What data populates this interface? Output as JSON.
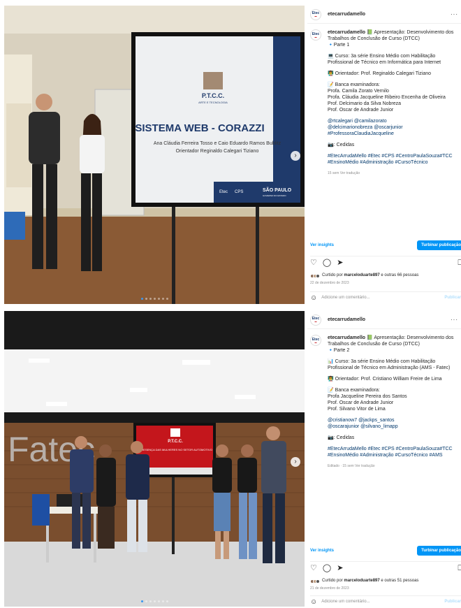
{
  "account": "etecarrudamello",
  "avatar_label": "Etec",
  "posts": [
    {
      "header_user": "etecarrudamello",
      "caption_user": "etecarrudamello",
      "lines": [
        [
          "📗 Apresentação: Desenvolvimento dos Trabalhos de Conclusão de Curso (DTCC)",
          "🔹Parte 1"
        ],
        [
          "💻 Curso: 3a série Ensino Médio com Habilitação Profissional de Técnico em Informática para Internet"
        ],
        [
          "👨‍🏫 Orientador: Prof. Reginaldo Calegari Tiziano"
        ],
        [
          "📝 Banca examinadora:",
          "Profa. Camila Zorato Vernilo",
          "Profa. Cláudia Jacqueline Ribeiro Encenha de Oliveira",
          "Prof. Delcimario da Silva Nobreza",
          "Prof. Oscar de Andrade Junior"
        ],
        [
          "@rtcalegari @camilazorato",
          "@delcimarionobreza @oscarjunior",
          "#ProfessoraClaudiaJacqueline"
        ],
        [
          "📷: Cedidas"
        ],
        [
          "#EtecArrudaMello #Etec #CPS #CentroPaulaSouza#TCC #EnsinoMédio #Administração #CursoTécnico"
        ]
      ],
      "meta": "15 sem   Ver tradução",
      "insights": "Ver insights",
      "boost": "Turbinar publicação",
      "liked_prefix": "Curtido por ",
      "liked_user": "marceloduarte897",
      "liked_suffix": " e outras 66 pessoas",
      "date": "22 de dezembro de 2023",
      "comment_placeholder": "Adicione um comentário...",
      "publish": "Publicar",
      "slide": {
        "title": "SISTEMA WEB - CORAZZI",
        "authors": "Ana Cláudia Ferreira Tosso e Caio Eduardo Ramos Bublitz",
        "advisor": "Orientador Reginaldo Calegari Tiziano",
        "logo_text": "P.T.C.C.",
        "logo_sub": "ARTE E TECNOLOGIA",
        "footer_etec": "Etec",
        "footer_cps": "CPS",
        "footer_sp": "SÃO PAULO",
        "footer_sp_sub": "GOVERNO DO ESTADO"
      },
      "dots": 7
    },
    {
      "header_user": "etecarrudamello",
      "caption_user": "etecarrudamello",
      "lines": [
        [
          "📗 Apresentação: Desenvolvimento dos Trabalhos de Conclusão de Curso (DTCC)",
          "🔹Parte 2"
        ],
        [
          "📊 Curso: 3a série Ensino Médio com Habilitação Profissional de Técnico em Administração (AMS - Fatec)"
        ],
        [
          "👨‍🏫 Orientador: Prof. Cristiano William Freire de Lima"
        ],
        [
          "📝 Banca examinadora:",
          "Profa Jacqueline Pereira dos Santos",
          "Prof. Oscar de Andrade Junior",
          "Prof. Silvano Vitor de Lima"
        ],
        [
          "@cristianow7 @jackps_santos",
          "@oscarajunior @silvano_limapp"
        ],
        [
          "📷: Cedidas"
        ],
        [
          "#EtecArrudaMello #Etec #CPS #CentroPaulaSouza#TCC #EnsinoMédio #Administração #CursoTécnico #AMS"
        ]
      ],
      "meta": "Editado · 15 sem   Ver tradução",
      "insights": "Ver insights",
      "boost": "Turbinar publicação",
      "liked_prefix": "Curtido por ",
      "liked_user": "marceloduarte897",
      "liked_suffix": " e outras 51 pessoas",
      "date": "21 de dezembro de 2023",
      "comment_placeholder": "Adicione um comentário...",
      "publish": "Publicar",
      "slide": {
        "title": "A PRESENÇA DAS MULHERES NO SETOR AUTOMOTIVO",
        "logo_text": "P.T.C.C.",
        "wall_text": "Fatec"
      },
      "dots": 7
    }
  ],
  "icons": {
    "heart": "♡",
    "comment": "◯",
    "share": "➤",
    "save": "⎕",
    "smile": "☺",
    "more": "···",
    "next": "›"
  },
  "colors": {
    "link_blue": "#0095f6",
    "tag_blue": "#00376b",
    "dot_active": "#3897f0",
    "slide_dark": "#1f3a6b",
    "slide_red": "#c4161c"
  }
}
